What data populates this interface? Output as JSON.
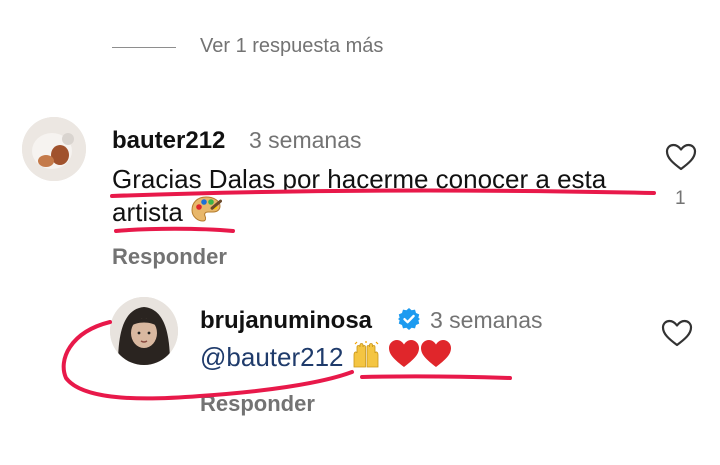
{
  "more_replies": {
    "label": "Ver 1 respuesta más"
  },
  "comments": [
    {
      "username": "bauter212",
      "time": "3 semanas",
      "text_line1": "Gracias Dalas por hacerme conocer a esta",
      "text_line2": "artista",
      "emoji": "palette-emoji",
      "like_count": "1",
      "reply_label": "Responder"
    },
    {
      "username": "brujanuminosa",
      "verified": true,
      "time": "3 semanas",
      "mention": "@bauter212",
      "emojis": [
        "raising-hands-emoji",
        "red-heart-emoji",
        "red-heart-emoji"
      ],
      "reply_label": "Responder"
    }
  ],
  "colors": {
    "annotation": "#e8194a",
    "verified_badge": "#1d9bf0",
    "muted_text": "#737373",
    "heart_red": "#e0262b"
  },
  "icons": {
    "like": "heart-outline-icon",
    "verified": "verified-badge-icon"
  }
}
